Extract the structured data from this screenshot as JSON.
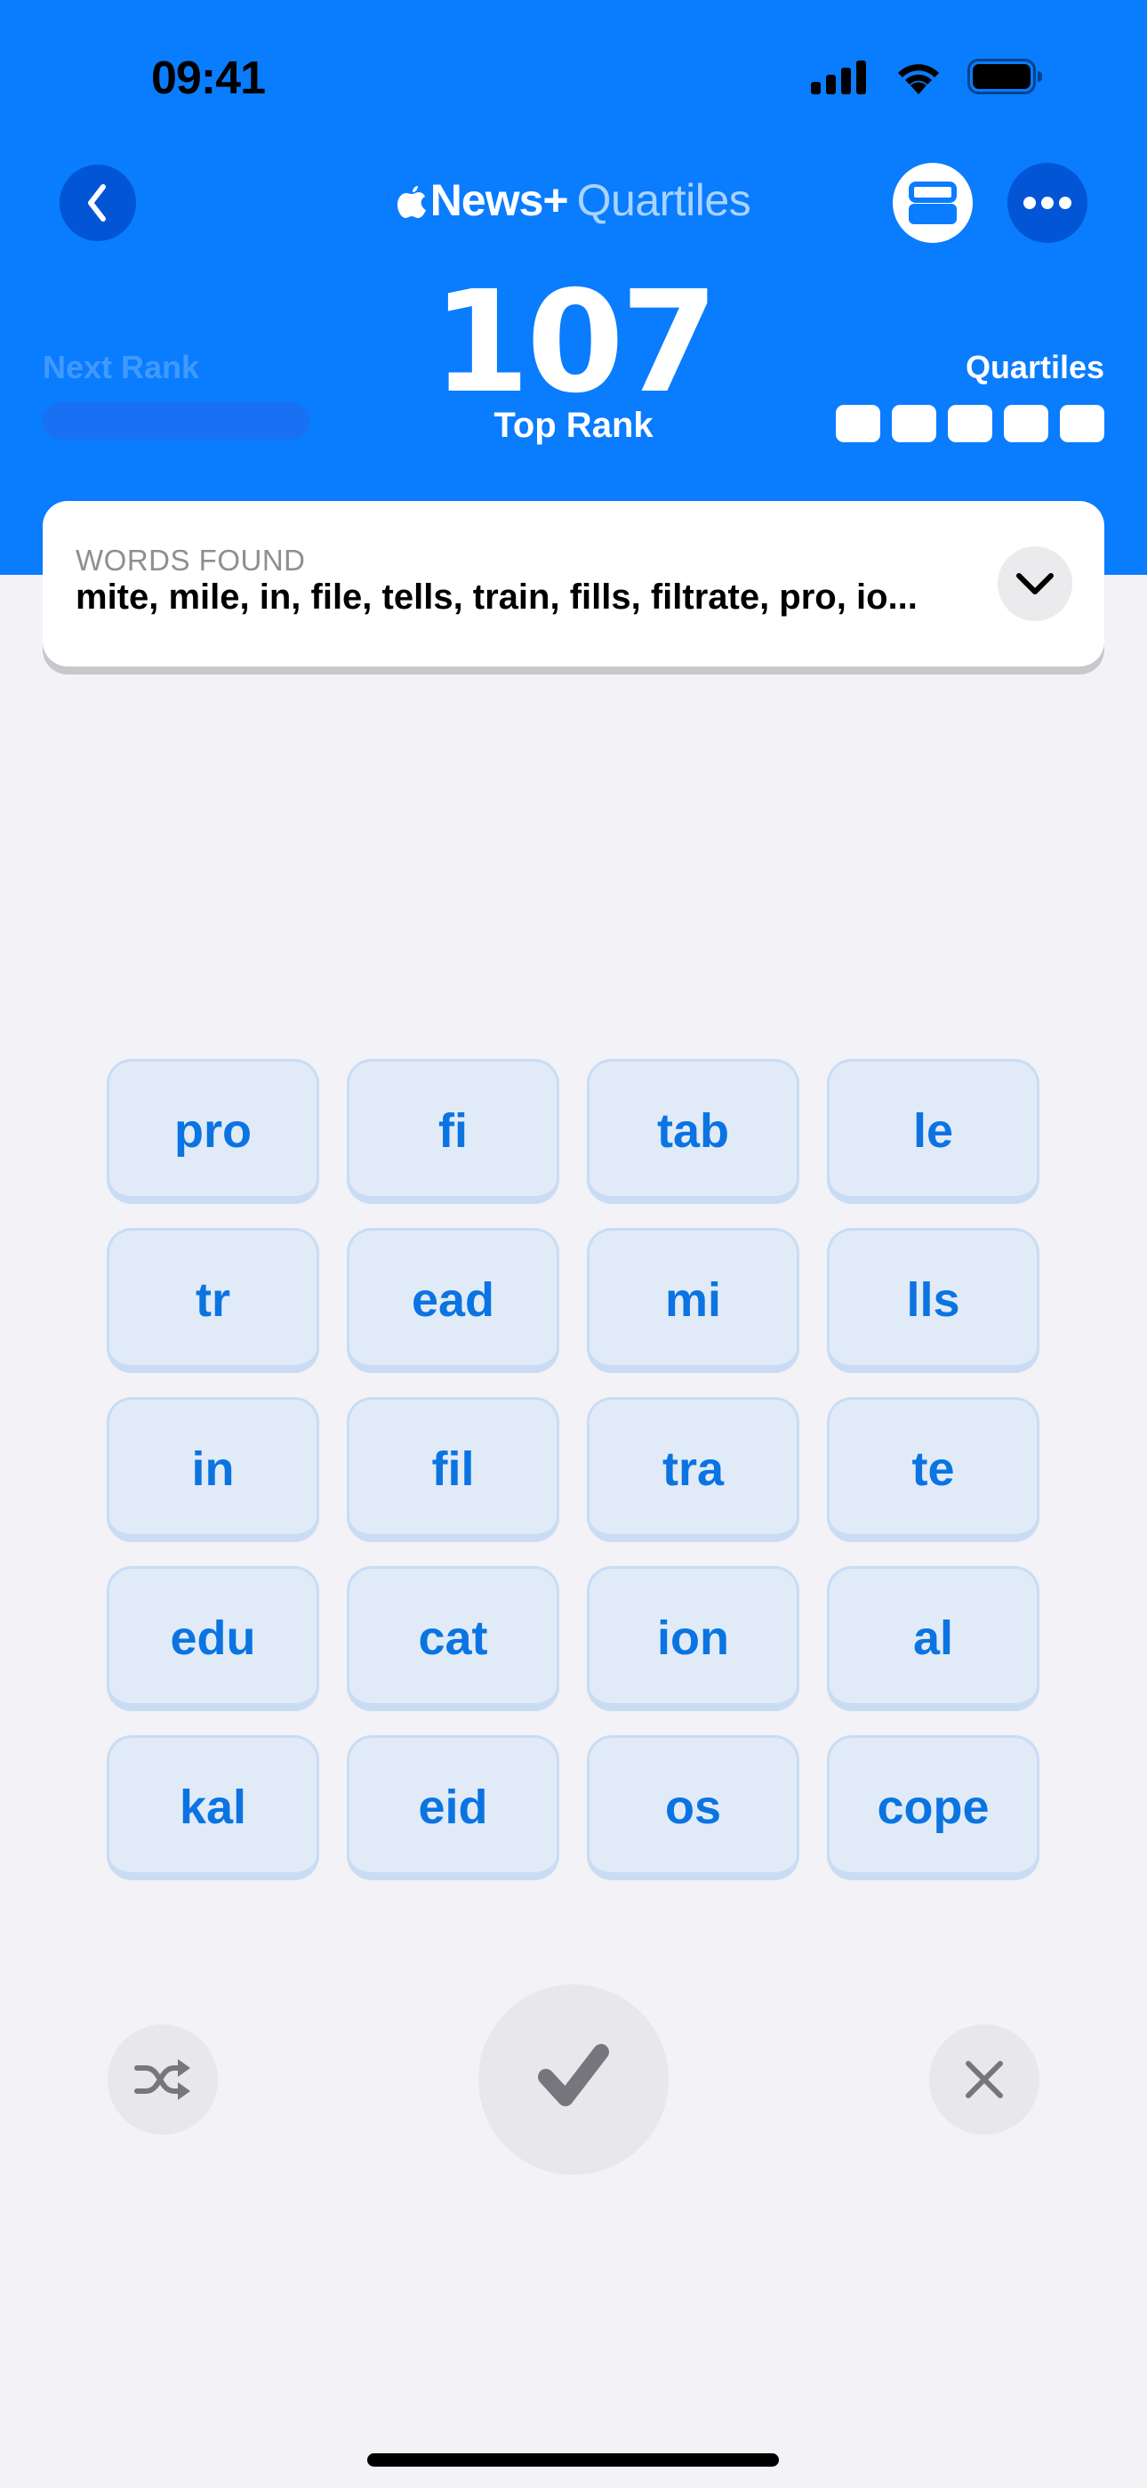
{
  "status_bar": {
    "time": "09:41",
    "signal_icon": "cellular-signal-icon",
    "wifi_icon": "wifi-icon",
    "battery_icon": "battery-icon"
  },
  "nav": {
    "back_icon": "chevron-left-icon",
    "title_brand": "News+",
    "title_brand_icon": "apple-logo-icon",
    "title_game": "Quartiles",
    "layout_icon": "stacked-rectangles-icon",
    "more_icon": "ellipsis-icon"
  },
  "stats": {
    "next_rank_label": "Next Rank",
    "next_rank_progress": 0,
    "score": "107",
    "rank": "Top Rank",
    "quartiles_label": "Quartiles",
    "quartiles_found": 5,
    "quartiles_total": 5
  },
  "words_found": {
    "label": "WORDS FOUND",
    "list_text": "mite, mile, in, file, tells, train, fills, filtrate, pro, io...",
    "expand_icon": "chevron-down-icon"
  },
  "tiles": [
    "pro",
    "fi",
    "tab",
    "le",
    "tr",
    "ead",
    "mi",
    "lls",
    "in",
    "fil",
    "tra",
    "te",
    "edu",
    "cat",
    "ion",
    "al",
    "kal",
    "eid",
    "os",
    "cope"
  ],
  "actions": {
    "shuffle_icon": "shuffle-icon",
    "submit_icon": "checkmark-icon",
    "clear_icon": "close-icon"
  },
  "colors": {
    "header_blue": "#0a7cfe",
    "button_dark_blue": "#0255d4",
    "tile_text": "#0b74e2",
    "tile_fill": "#e1ebf7",
    "background": "#f2f2f7"
  }
}
